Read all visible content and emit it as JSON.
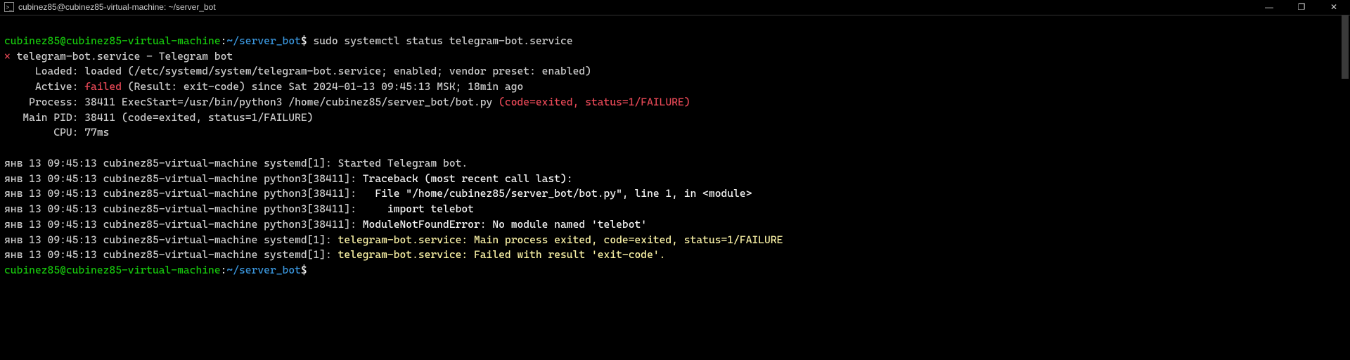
{
  "window": {
    "title": "cubinez85@cubinez85-virtual-machine: ~/server_bot",
    "controls": {
      "minimize": "—",
      "maximize": "❐",
      "close": "✕"
    }
  },
  "prompt": {
    "userhost": "cubinez85@cubinez85-virtual-machine",
    "sep": ":",
    "path": "~/server_bot",
    "dollar": "$",
    "command": " sudo systemctl status telegram-bot.service"
  },
  "status": {
    "bullet": "×",
    "unit_line": " telegram-bot.service - Telegram bot",
    "loaded_label": "     Loaded: ",
    "loaded_value": "loaded (/etc/systemd/system/telegram-bot.service; enabled; vendor preset: enabled)",
    "active_label": "     Active: ",
    "active_state": "failed",
    "active_rest": " (Result: exit-code) since Sat 2024-01-13 09:45:13 MSK; 18min ago",
    "process_label": "    Process: ",
    "process_value": "38411 ExecStart=/usr/bin/python3 /home/cubinez85/server_bot/bot.py ",
    "process_status": "(code=exited, status=1/FAILURE)",
    "mainpid_label": "   Main PID: ",
    "mainpid_value": "38411 (code=exited, status=1/FAILURE)",
    "cpu_label": "        CPU: ",
    "cpu_value": "77ms"
  },
  "log": {
    "l1_pre": "янв 13 09:45:13 cubinez85-virtual-machine systemd[1]: Started Telegram bot.",
    "l2_pre": "янв 13 09:45:13 cubinez85-virtual-machine python3[38411]: ",
    "l2_msg": "Traceback (most recent call last):",
    "l3_pre": "янв 13 09:45:13 cubinez85-virtual-machine python3[38411]:   ",
    "l3_msg": "File \"/home/cubinez85/server_bot/bot.py\", line 1, in <module>",
    "l4_pre": "янв 13 09:45:13 cubinez85-virtual-machine python3[38411]:     ",
    "l4_msg": "import telebot",
    "l5_pre": "янв 13 09:45:13 cubinez85-virtual-machine python3[38411]: ",
    "l5_msg": "ModuleNotFoundError: No module named 'telebot'",
    "l6_pre": "янв 13 09:45:13 cubinez85-virtual-machine systemd[1]: ",
    "l6_msg": "telegram-bot.service: Main process exited, code=exited, status=1/FAILURE",
    "l7_pre": "янв 13 09:45:13 cubinez85-virtual-machine systemd[1]: ",
    "l7_msg": "telegram-bot.service: Failed with result 'exit-code'."
  }
}
